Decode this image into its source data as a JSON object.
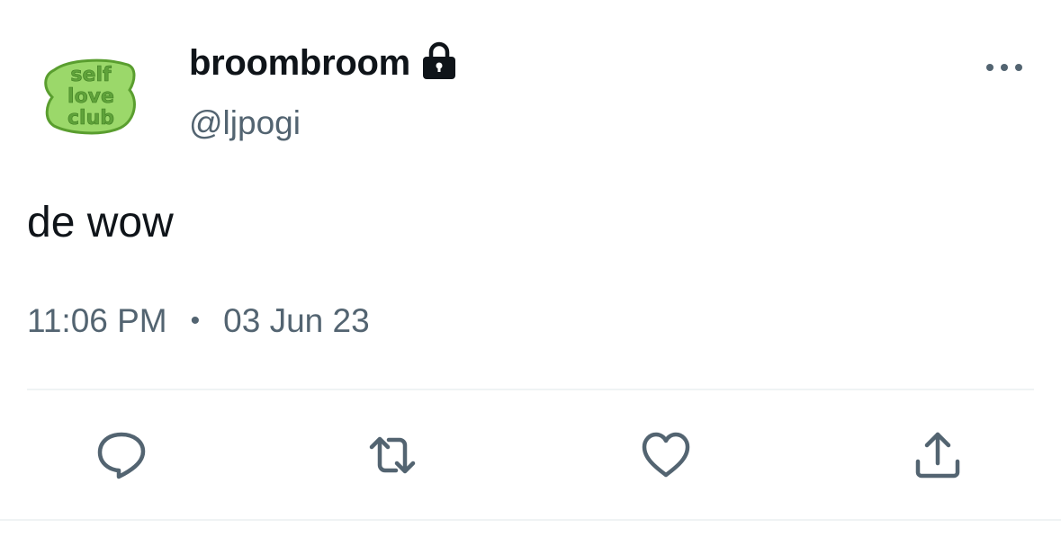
{
  "tweet": {
    "avatar": {
      "text_lines": [
        "self",
        "love",
        "club"
      ],
      "colors": {
        "fill": "#9bd86a",
        "outline": "#5a9e2f",
        "text": "#5fa23a"
      }
    },
    "author": {
      "display_name": "broombroom",
      "handle": "@ljpogi",
      "protected": true
    },
    "text": "de wow",
    "time": "11:06 PM",
    "separator": "•",
    "date": "03 Jun 23",
    "actions": [
      "reply-icon",
      "retweet-icon",
      "like-icon",
      "share-icon"
    ],
    "icon_color": "#536471"
  }
}
